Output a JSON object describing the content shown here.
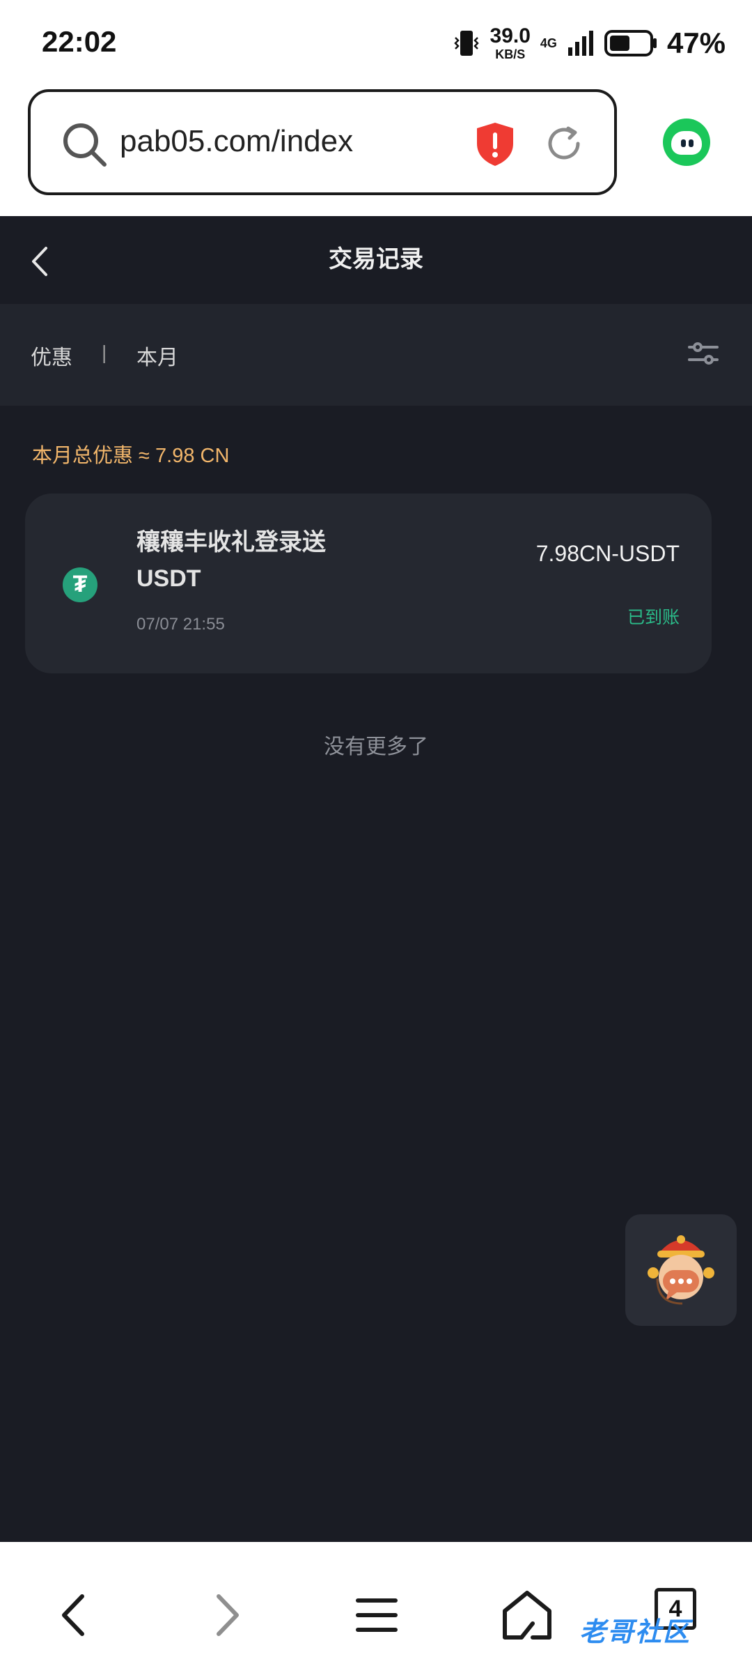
{
  "status": {
    "time": "22:02",
    "speed_value": "39.0",
    "speed_unit": "KB/S",
    "network": "4G",
    "battery": "47%"
  },
  "browser": {
    "url": "pab05.com/index"
  },
  "header": {
    "title": "交易记录"
  },
  "filters": {
    "type": "优惠",
    "separator": "|",
    "period": "本月"
  },
  "summary": "本月总优惠 ≈ 7.98 CN",
  "records": [
    {
      "icon": "tether-icon",
      "title": "穰穰丰收礼登录送USDT",
      "date": "07/07 21:55",
      "amount": "7.98CN-USDT",
      "status": "已到账"
    }
  ],
  "no_more": "没有更多了",
  "bottom_nav": {
    "tab_count": "4"
  },
  "watermark": "老哥社区",
  "colors": {
    "background": "#1a1c24",
    "accent_orange": "#f2b66b",
    "status_green": "#2bbc8a",
    "tether_green": "#26a17b"
  }
}
